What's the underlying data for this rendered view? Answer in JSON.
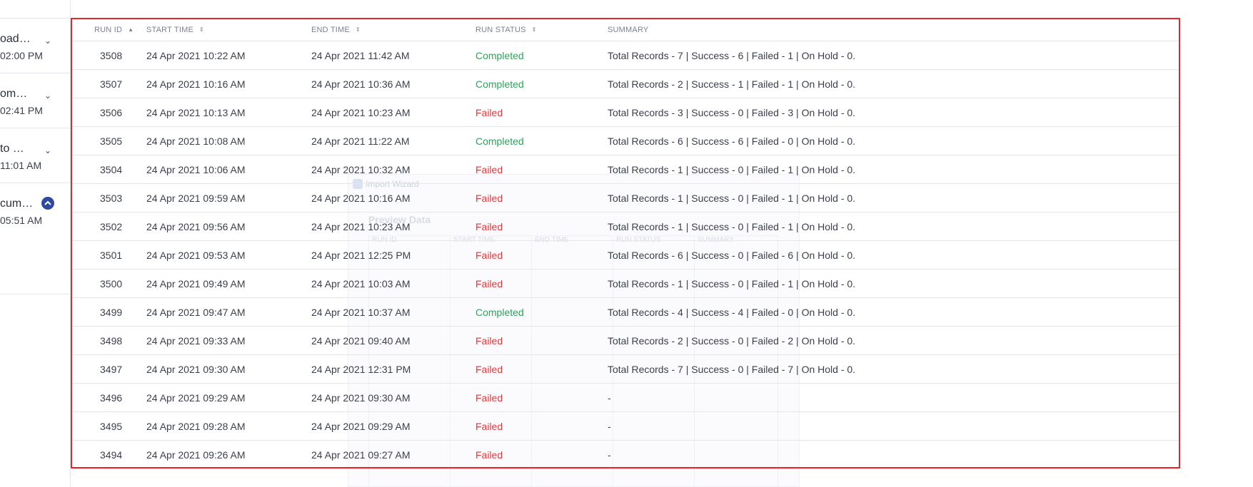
{
  "sidebar": {
    "items": [
      {
        "title": "oad…",
        "time": "02:00 PM"
      },
      {
        "title": "om…",
        "time": "02:41 PM"
      },
      {
        "title": "to …",
        "time": "11:01 AM"
      },
      {
        "title": "cum…",
        "time": "05:51 AM"
      }
    ]
  },
  "wizard": {
    "title": "Import Wizard",
    "heading": "Preview Data",
    "headers": [
      "RUN ID",
      "START TIME",
      "END TIME",
      "RUN STATUS",
      "SUMMARY"
    ]
  },
  "table": {
    "headers": {
      "run_id": "RUN ID",
      "start_time": "START TIME",
      "end_time": "END TIME",
      "run_status": "RUN STATUS",
      "summary": "SUMMARY"
    },
    "rows": [
      {
        "run_id": "3508",
        "start": "24 Apr 2021 10:22 AM",
        "end": "24 Apr 2021 11:42 AM",
        "status": "Completed",
        "summary": "Total Records - 7 | Success - 6 | Failed - 1 | On Hold - 0."
      },
      {
        "run_id": "3507",
        "start": "24 Apr 2021 10:16 AM",
        "end": "24 Apr 2021 10:36 AM",
        "status": "Completed",
        "summary": "Total Records - 2 | Success - 1 | Failed - 1 | On Hold - 0."
      },
      {
        "run_id": "3506",
        "start": "24 Apr 2021 10:13 AM",
        "end": "24 Apr 2021 10:23 AM",
        "status": "Failed",
        "summary": "Total Records - 3 | Success - 0 | Failed - 3 | On Hold - 0."
      },
      {
        "run_id": "3505",
        "start": "24 Apr 2021 10:08 AM",
        "end": "24 Apr 2021 11:22 AM",
        "status": "Completed",
        "summary": "Total Records - 6 | Success - 6 | Failed - 0 | On Hold - 0."
      },
      {
        "run_id": "3504",
        "start": "24 Apr 2021 10:06 AM",
        "end": "24 Apr 2021 10:32 AM",
        "status": "Failed",
        "summary": "Total Records - 1 | Success - 0 | Failed - 1 | On Hold - 0."
      },
      {
        "run_id": "3503",
        "start": "24 Apr 2021 09:59 AM",
        "end": "24 Apr 2021 10:16 AM",
        "status": "Failed",
        "summary": "Total Records - 1 | Success - 0 | Failed - 1 | On Hold - 0."
      },
      {
        "run_id": "3502",
        "start": "24 Apr 2021 09:56 AM",
        "end": "24 Apr 2021 10:23 AM",
        "status": "Failed",
        "summary": "Total Records - 1 | Success - 0 | Failed - 1 | On Hold - 0."
      },
      {
        "run_id": "3501",
        "start": "24 Apr 2021 09:53 AM",
        "end": "24 Apr 2021 12:25 PM",
        "status": "Failed",
        "summary": "Total Records - 6 | Success - 0 | Failed - 6 | On Hold - 0."
      },
      {
        "run_id": "3500",
        "start": "24 Apr 2021 09:49 AM",
        "end": "24 Apr 2021 10:03 AM",
        "status": "Failed",
        "summary": "Total Records - 1 | Success - 0 | Failed - 1 | On Hold - 0."
      },
      {
        "run_id": "3499",
        "start": "24 Apr 2021 09:47 AM",
        "end": "24 Apr 2021 10:37 AM",
        "status": "Completed",
        "summary": "Total Records - 4 | Success - 4 | Failed - 0 | On Hold - 0."
      },
      {
        "run_id": "3498",
        "start": "24 Apr 2021 09:33 AM",
        "end": "24 Apr 2021 09:40 AM",
        "status": "Failed",
        "summary": "Total Records - 2 | Success - 0 | Failed - 2 | On Hold - 0."
      },
      {
        "run_id": "3497",
        "start": "24 Apr 2021 09:30 AM",
        "end": "24 Apr 2021 12:31 PM",
        "status": "Failed",
        "summary": "Total Records - 7 | Success - 0 | Failed - 7 | On Hold - 0."
      },
      {
        "run_id": "3496",
        "start": "24 Apr 2021 09:29 AM",
        "end": "24 Apr 2021 09:30 AM",
        "status": "Failed",
        "summary": "-"
      },
      {
        "run_id": "3495",
        "start": "24 Apr 2021 09:28 AM",
        "end": "24 Apr 2021 09:29 AM",
        "status": "Failed",
        "summary": "-"
      },
      {
        "run_id": "3494",
        "start": "24 Apr 2021 09:26 AM",
        "end": "24 Apr 2021 09:27 AM",
        "status": "Failed",
        "summary": "-"
      }
    ]
  },
  "colors": {
    "highlight_border": "#e8262a",
    "completed": "#2ea35a",
    "failed": "#e2363d",
    "accent": "#2f4a9d"
  }
}
